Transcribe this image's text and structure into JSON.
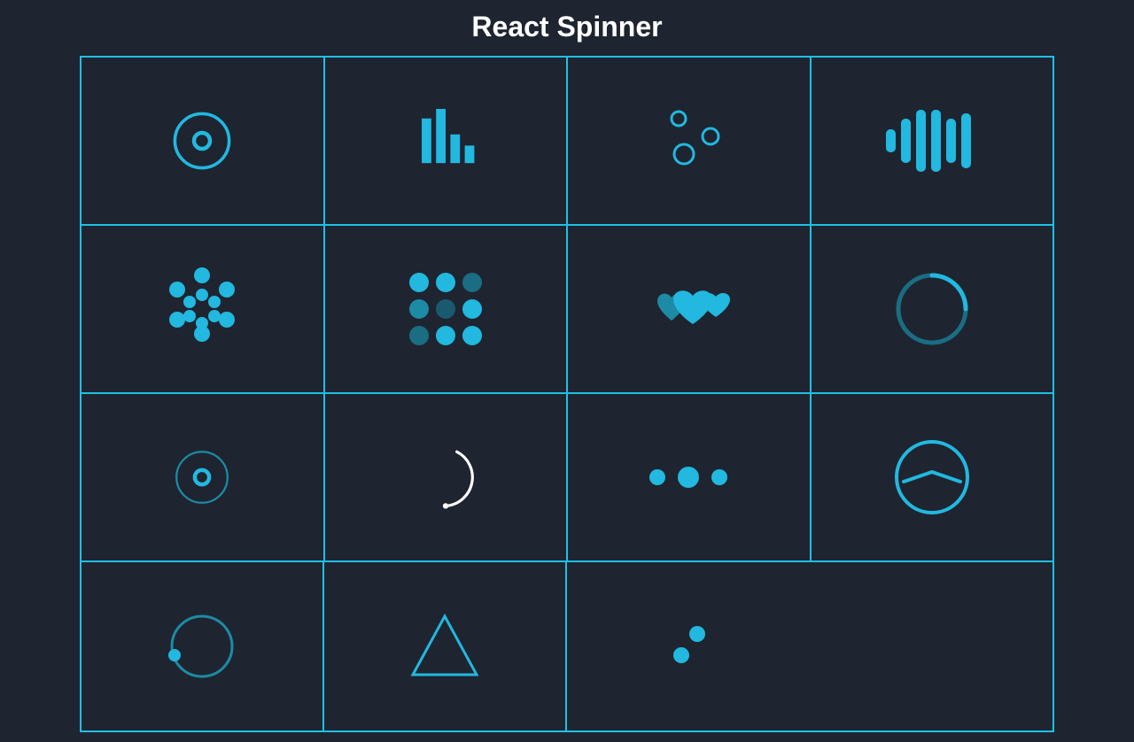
{
  "title": "React Spinner",
  "accent": "#22b8e0",
  "accent_faint": "#1a6d83",
  "white": "#ffffff",
  "spinners": [
    "circles-with-bar",
    "bars",
    "bubbles",
    "audio",
    "dot-cluster",
    "grid",
    "hearts",
    "oval",
    "radio",
    "tail-spin",
    "three-dots",
    "watch",
    "revolving-dot",
    "triangle",
    "two-dots"
  ]
}
